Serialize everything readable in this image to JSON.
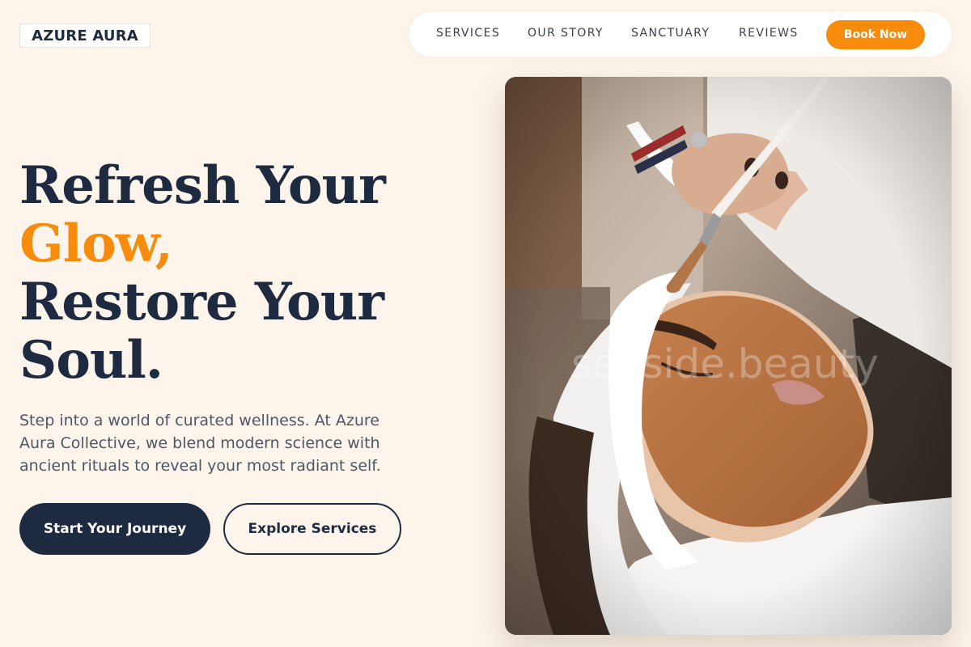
{
  "brand": {
    "logo": "AZURE AURA"
  },
  "nav": {
    "links": [
      "SERVICES",
      "OUR STORY",
      "SANCTUARY",
      "REVIEWS"
    ],
    "cta": "Book Now"
  },
  "hero": {
    "headline_1": "Refresh Your",
    "headline_accent": "Glow,",
    "headline_2": "Restore Your",
    "headline_3": "Soul.",
    "description": "Step into a world of curated wellness. At Azure Aura Collective, we blend modern science with ancient rituals to reveal your most radiant self.",
    "primary_cta": "Start Your Journey",
    "secondary_cta": "Explore Services",
    "image_watermark": "seaside.beauty"
  },
  "colors": {
    "background": "#fdf5ec",
    "navy": "#1e2a40",
    "accent": "#f78b0b",
    "white": "#ffffff"
  }
}
